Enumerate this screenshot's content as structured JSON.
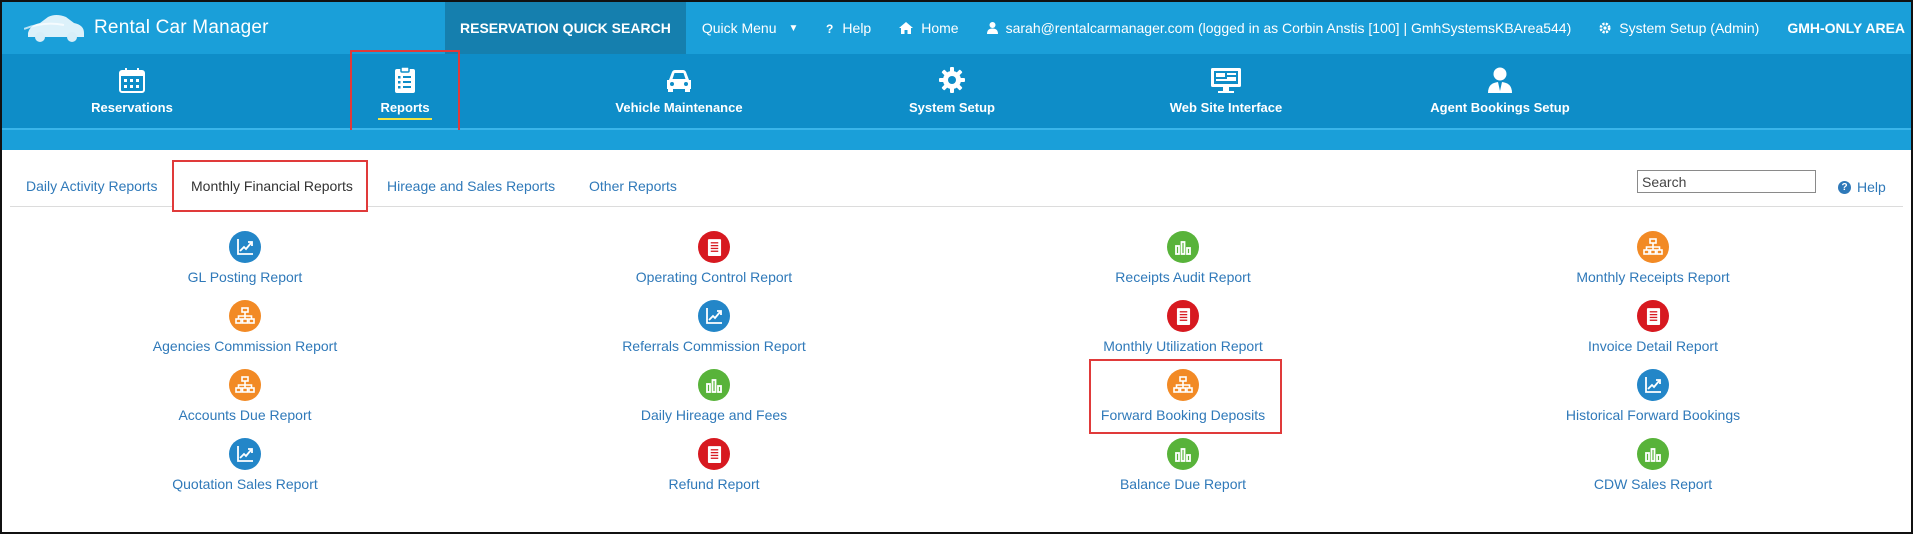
{
  "app": {
    "title": "Rental Car Manager"
  },
  "topnav": {
    "quick_search": "RESERVATION QUICK SEARCH",
    "quick_menu": "Quick Menu",
    "help": "Help",
    "home": "Home",
    "user": "sarah@rentalcarmanager.com (logged in as Corbin Anstis [100] | GmhSystemsKBArea544)",
    "system_setup": "System Setup (Admin)",
    "gmh_only": "GMH-ONLY AREA"
  },
  "modules": [
    {
      "label": "Reservations",
      "icon": "calendar-icon"
    },
    {
      "label": "Reports",
      "icon": "clipboard-icon"
    },
    {
      "label": "Vehicle Maintenance",
      "icon": "car-icon"
    },
    {
      "label": "System Setup",
      "icon": "gear-icon"
    },
    {
      "label": "Web Site Interface",
      "icon": "monitor-icon"
    },
    {
      "label": "Agent Bookings Setup",
      "icon": "agent-icon"
    }
  ],
  "tabs": [
    {
      "label": "Daily Activity Reports"
    },
    {
      "label": "Monthly Financial Reports"
    },
    {
      "label": "Hireage and Sales Reports"
    },
    {
      "label": "Other Reports"
    }
  ],
  "active_tab": "Monthly Financial Reports",
  "search": {
    "placeholder": "Search"
  },
  "help_link": "Help",
  "colors": {
    "topbar": "#1a9fd9",
    "modbar": "#0e8dc8",
    "link": "#2f79b9",
    "highlight": "#e03a3a"
  },
  "reports": [
    [
      {
        "label": "GL Posting Report",
        "icon": "chart-icon",
        "color": "blue"
      },
      {
        "label": "Agencies Commission Report",
        "icon": "hierarchy-icon",
        "color": "orange"
      },
      {
        "label": "Accounts Due Report",
        "icon": "hierarchy-icon",
        "color": "orange"
      },
      {
        "label": "Quotation Sales Report",
        "icon": "chart-icon",
        "color": "blue"
      }
    ],
    [
      {
        "label": "Operating Control Report",
        "icon": "document-icon",
        "color": "red"
      },
      {
        "label": "Referrals Commission Report",
        "icon": "chart-icon",
        "color": "blue"
      },
      {
        "label": "Daily Hireage and Fees",
        "icon": "bar-chart-icon",
        "color": "green"
      },
      {
        "label": "Refund Report",
        "icon": "document-icon",
        "color": "red"
      }
    ],
    [
      {
        "label": "Receipts Audit Report",
        "icon": "bar-chart-icon",
        "color": "green"
      },
      {
        "label": "Monthly Utilization Report",
        "icon": "document-icon",
        "color": "red"
      },
      {
        "label": "Forward Booking Deposits",
        "icon": "hierarchy-icon",
        "color": "orange"
      },
      {
        "label": "Balance Due Report",
        "icon": "bar-chart-icon",
        "color": "green"
      }
    ],
    [
      {
        "label": "Monthly Receipts Report",
        "icon": "hierarchy-icon",
        "color": "orange"
      },
      {
        "label": "Invoice Detail Report",
        "icon": "document-icon",
        "color": "red"
      },
      {
        "label": "Historical Forward Bookings",
        "icon": "chart-icon",
        "color": "blue"
      },
      {
        "label": "CDW Sales Report",
        "icon": "bar-chart-icon",
        "color": "green"
      }
    ]
  ]
}
